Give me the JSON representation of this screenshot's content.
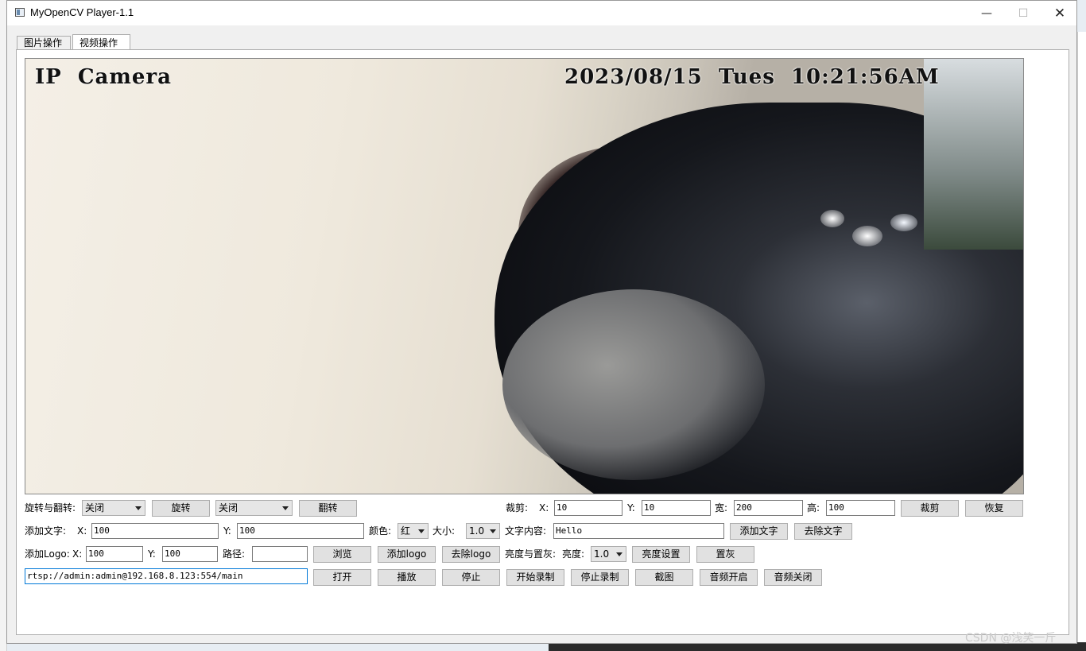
{
  "window": {
    "title": "MyOpenCV Player-1.1"
  },
  "tabs": [
    {
      "label": "图片操作"
    },
    {
      "label": "视频操作"
    }
  ],
  "video": {
    "osd_left": "IP  Camera",
    "osd_right": "2023/08/15  Tues  10:21:56AM"
  },
  "row1": {
    "rotate_label": "旋转与翻转:",
    "rotate_select": "关闭",
    "rotate_button": "旋转",
    "flip_select": "关闭",
    "flip_button": "翻转",
    "crop_label": "裁剪:",
    "x_label": "X:",
    "x_value": "10",
    "y_label": "Y:",
    "y_value": "10",
    "w_label": "宽:",
    "w_value": "200",
    "h_label": "高:",
    "h_value": "100",
    "crop_button": "裁剪",
    "restore_button": "恢复"
  },
  "row2": {
    "label": "添加文字:",
    "x_label": "X:",
    "x_value": "100",
    "y_label": "Y:",
    "y_value": "100",
    "color_label": "颜色:",
    "color_select": "红",
    "size_label": "大小:",
    "size_select": "1.0",
    "content_label": "文字内容:",
    "content_value": "Hello",
    "add_button": "添加文字",
    "remove_button": "去除文字"
  },
  "row3": {
    "label": "添加Logo:",
    "x_label": "X:",
    "x_value": "100",
    "y_label": "Y:",
    "y_value": "100",
    "path_label": "路径:",
    "path_value": "",
    "browse_button": "浏览",
    "add_button": "添加logo",
    "remove_button": "去除logo",
    "bright_label": "亮度与置灰:",
    "bright_sub_label": "亮度:",
    "bright_select": "1.0",
    "bright_button": "亮度设置",
    "gray_button": "置灰"
  },
  "row4": {
    "url_value": "rtsp://admin:admin@192.168.8.123:554/main",
    "buttons": [
      "打开",
      "播放",
      "停止",
      "开始录制",
      "停止录制",
      "截图",
      "音频开启",
      "音频关闭"
    ]
  },
  "desktop": {
    "watermark": "CSDN @浅笑一斤"
  }
}
